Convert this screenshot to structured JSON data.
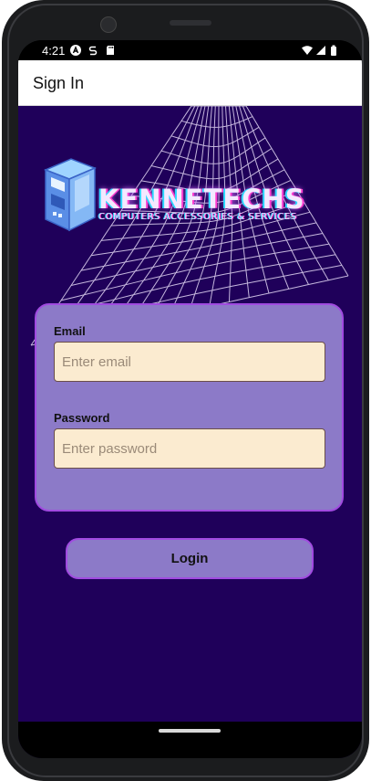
{
  "status_bar": {
    "time": "4:21",
    "icons": [
      "a-badge-icon",
      "s-notification-icon",
      "sd-card-icon",
      "wifi-icon",
      "signal-icon",
      "battery-icon"
    ]
  },
  "app_bar": {
    "title": "Sign In"
  },
  "brand": {
    "title": "KENNETECHS",
    "tagline": "COMPUTERS ACCESSORIES & SERVICES"
  },
  "form": {
    "email": {
      "label": "Email",
      "placeholder": "Enter email",
      "value": ""
    },
    "password": {
      "label": "Password",
      "placeholder": "Enter password",
      "value": ""
    }
  },
  "login_button": {
    "label": "Login"
  },
  "colors": {
    "background": "#1f005a",
    "card": "#8c7ac8",
    "card_border": "#a14be0",
    "input_bg": "#fbebd0"
  }
}
